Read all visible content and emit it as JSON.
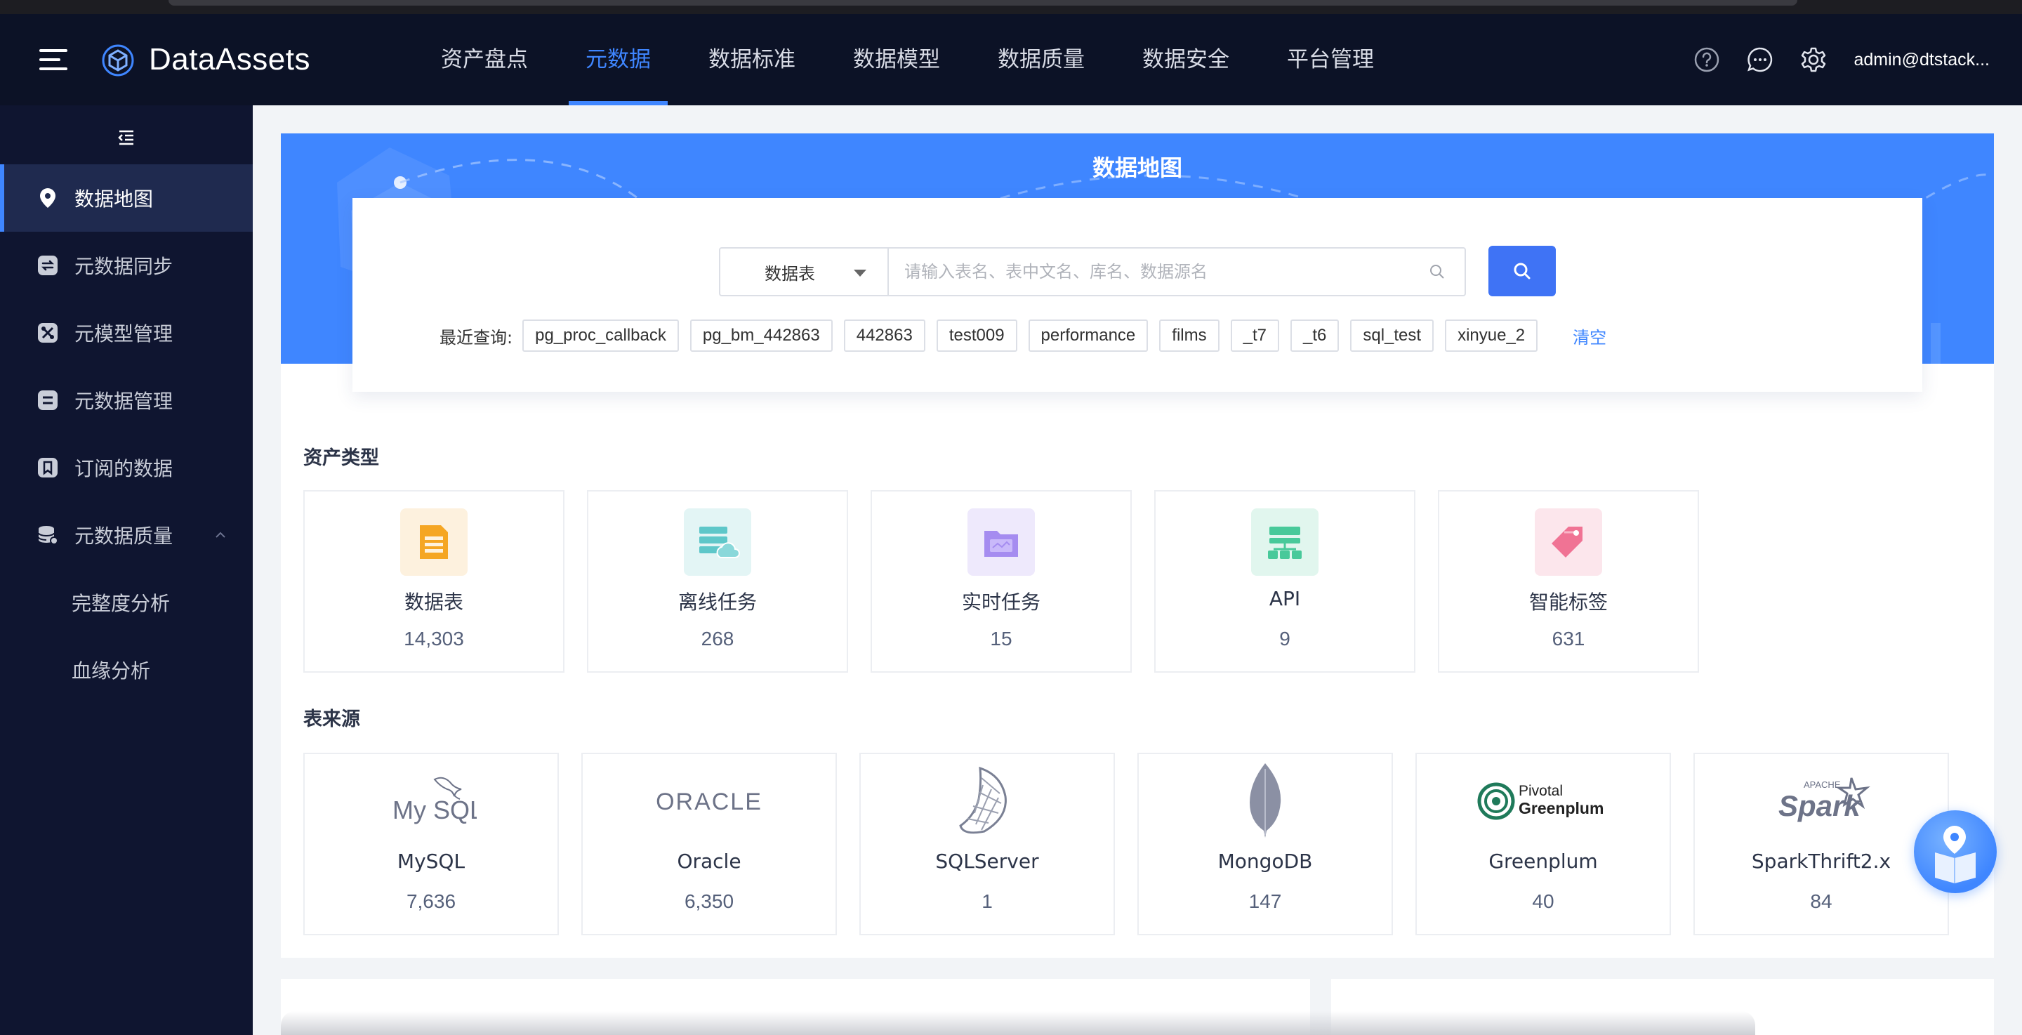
{
  "app": {
    "name": "DataAssets"
  },
  "nav": {
    "items": [
      {
        "label": "资产盘点",
        "active": false
      },
      {
        "label": "元数据",
        "active": true
      },
      {
        "label": "数据标准",
        "active": false
      },
      {
        "label": "数据模型",
        "active": false
      },
      {
        "label": "数据质量",
        "active": false
      },
      {
        "label": "数据安全",
        "active": false
      },
      {
        "label": "平台管理",
        "active": false
      }
    ],
    "user": "admin@dtstack..."
  },
  "sidebar": {
    "items": [
      {
        "label": "数据地图",
        "icon": "location-pin-icon",
        "active": true
      },
      {
        "label": "元数据同步",
        "icon": "sync-icon"
      },
      {
        "label": "元模型管理",
        "icon": "model-icon"
      },
      {
        "label": "元数据管理",
        "icon": "list-icon"
      },
      {
        "label": "订阅的数据",
        "icon": "bookmark-icon"
      },
      {
        "label": "元数据质量",
        "icon": "database-icon",
        "expanded": true
      }
    ],
    "sub_items": [
      {
        "label": "完整度分析"
      },
      {
        "label": "血缘分析"
      }
    ]
  },
  "hero": {
    "title": "数据地图"
  },
  "search": {
    "type_selected": "数据表",
    "placeholder": "请输入表名、表中文名、库名、数据源名",
    "value": ""
  },
  "recent": {
    "label": "最近查询:",
    "tags": [
      "pg_proc_callback",
      "pg_bm_442863",
      "442863",
      "test009",
      "performance",
      "films",
      "_t7",
      "_t6",
      "sql_test",
      "xinyue_2"
    ],
    "clear_label": "清空"
  },
  "asset_types": {
    "title": "资产类型",
    "cards": [
      {
        "name": "数据表",
        "count": "14,303",
        "icon": "table-icon",
        "color": "#f5a623",
        "bg": "#fdf1de"
      },
      {
        "name": "离线任务",
        "count": "268",
        "icon": "offline-task-icon",
        "color": "#5ec7c9",
        "bg": "#e3f5f5"
      },
      {
        "name": "实时任务",
        "count": "15",
        "icon": "realtime-task-icon",
        "color": "#a58cf0",
        "bg": "#eee9fc"
      },
      {
        "name": "API",
        "count": "9",
        "icon": "api-icon",
        "color": "#48c99a",
        "bg": "#e1f6ee"
      },
      {
        "name": "智能标签",
        "count": "631",
        "icon": "tag-icon",
        "color": "#f07394",
        "bg": "#fce6ec"
      }
    ]
  },
  "table_sources": {
    "title": "表来源",
    "cards": [
      {
        "name": "MySQL",
        "count": "7,636",
        "icon": "mysql-logo-icon"
      },
      {
        "name": "Oracle",
        "count": "6,350",
        "icon": "oracle-logo-icon"
      },
      {
        "name": "SQLServer",
        "count": "1",
        "icon": "sqlserver-logo-icon"
      },
      {
        "name": "MongoDB",
        "count": "147",
        "icon": "mongodb-logo-icon"
      },
      {
        "name": "Greenplum",
        "count": "40",
        "icon": "greenplum-logo-icon"
      },
      {
        "name": "SparkThrift2.x",
        "count": "84",
        "icon": "spark-logo-icon"
      }
    ]
  },
  "logos": {
    "mysql": "My SQL",
    "oracle": "ORACLE",
    "greenplum_top": "Pivotal",
    "greenplum_bottom": "Greenplum",
    "spark_top": "APACHE",
    "spark": "Spark"
  },
  "colors": {
    "accent": "#3f86ff",
    "header_bg": "#0c1226",
    "sidebar_bg": "#0f1530"
  }
}
